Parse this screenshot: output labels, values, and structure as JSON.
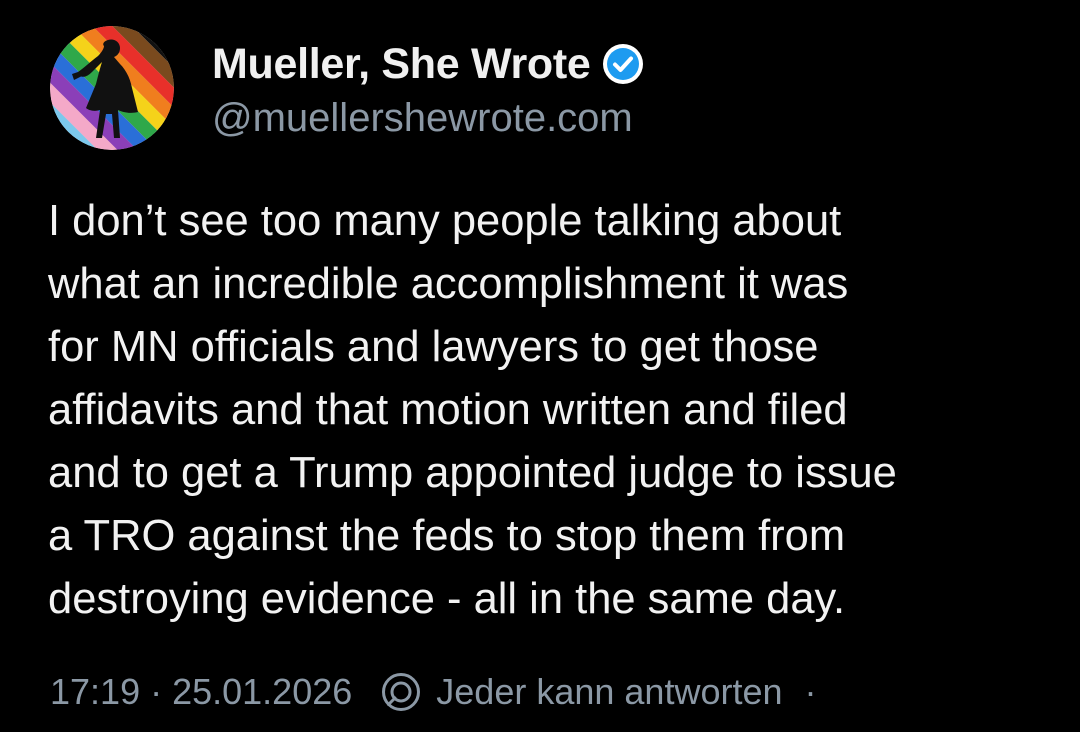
{
  "post": {
    "author": {
      "display_name": "Mueller, She Wrote",
      "handle": "@muellershewrote.com",
      "verified": true,
      "avatar": "rainbow-silhouette-avatar"
    },
    "text_lines": [
      "I don’t see too many people talking about",
      "what an incredible accomplishment it was",
      "for MN officials and lawyers to get those",
      "affidavits and that motion written and filed",
      "and to get a Trump appointed judge to issue",
      "a TRO against the feds to stop them from",
      "destroying evidence - all in the same day."
    ],
    "meta": {
      "time": "17:19",
      "separator": "·",
      "date": "25.01.2026",
      "reply_icon": "reply-settings-icon",
      "reply_setting": "Jeder kann antworten",
      "trailing_separator": "·"
    }
  },
  "colors": {
    "background": "#000000",
    "text": "#f2f2f2",
    "secondary": "#8b98a5",
    "verified_badge": "#1d9bf0"
  }
}
